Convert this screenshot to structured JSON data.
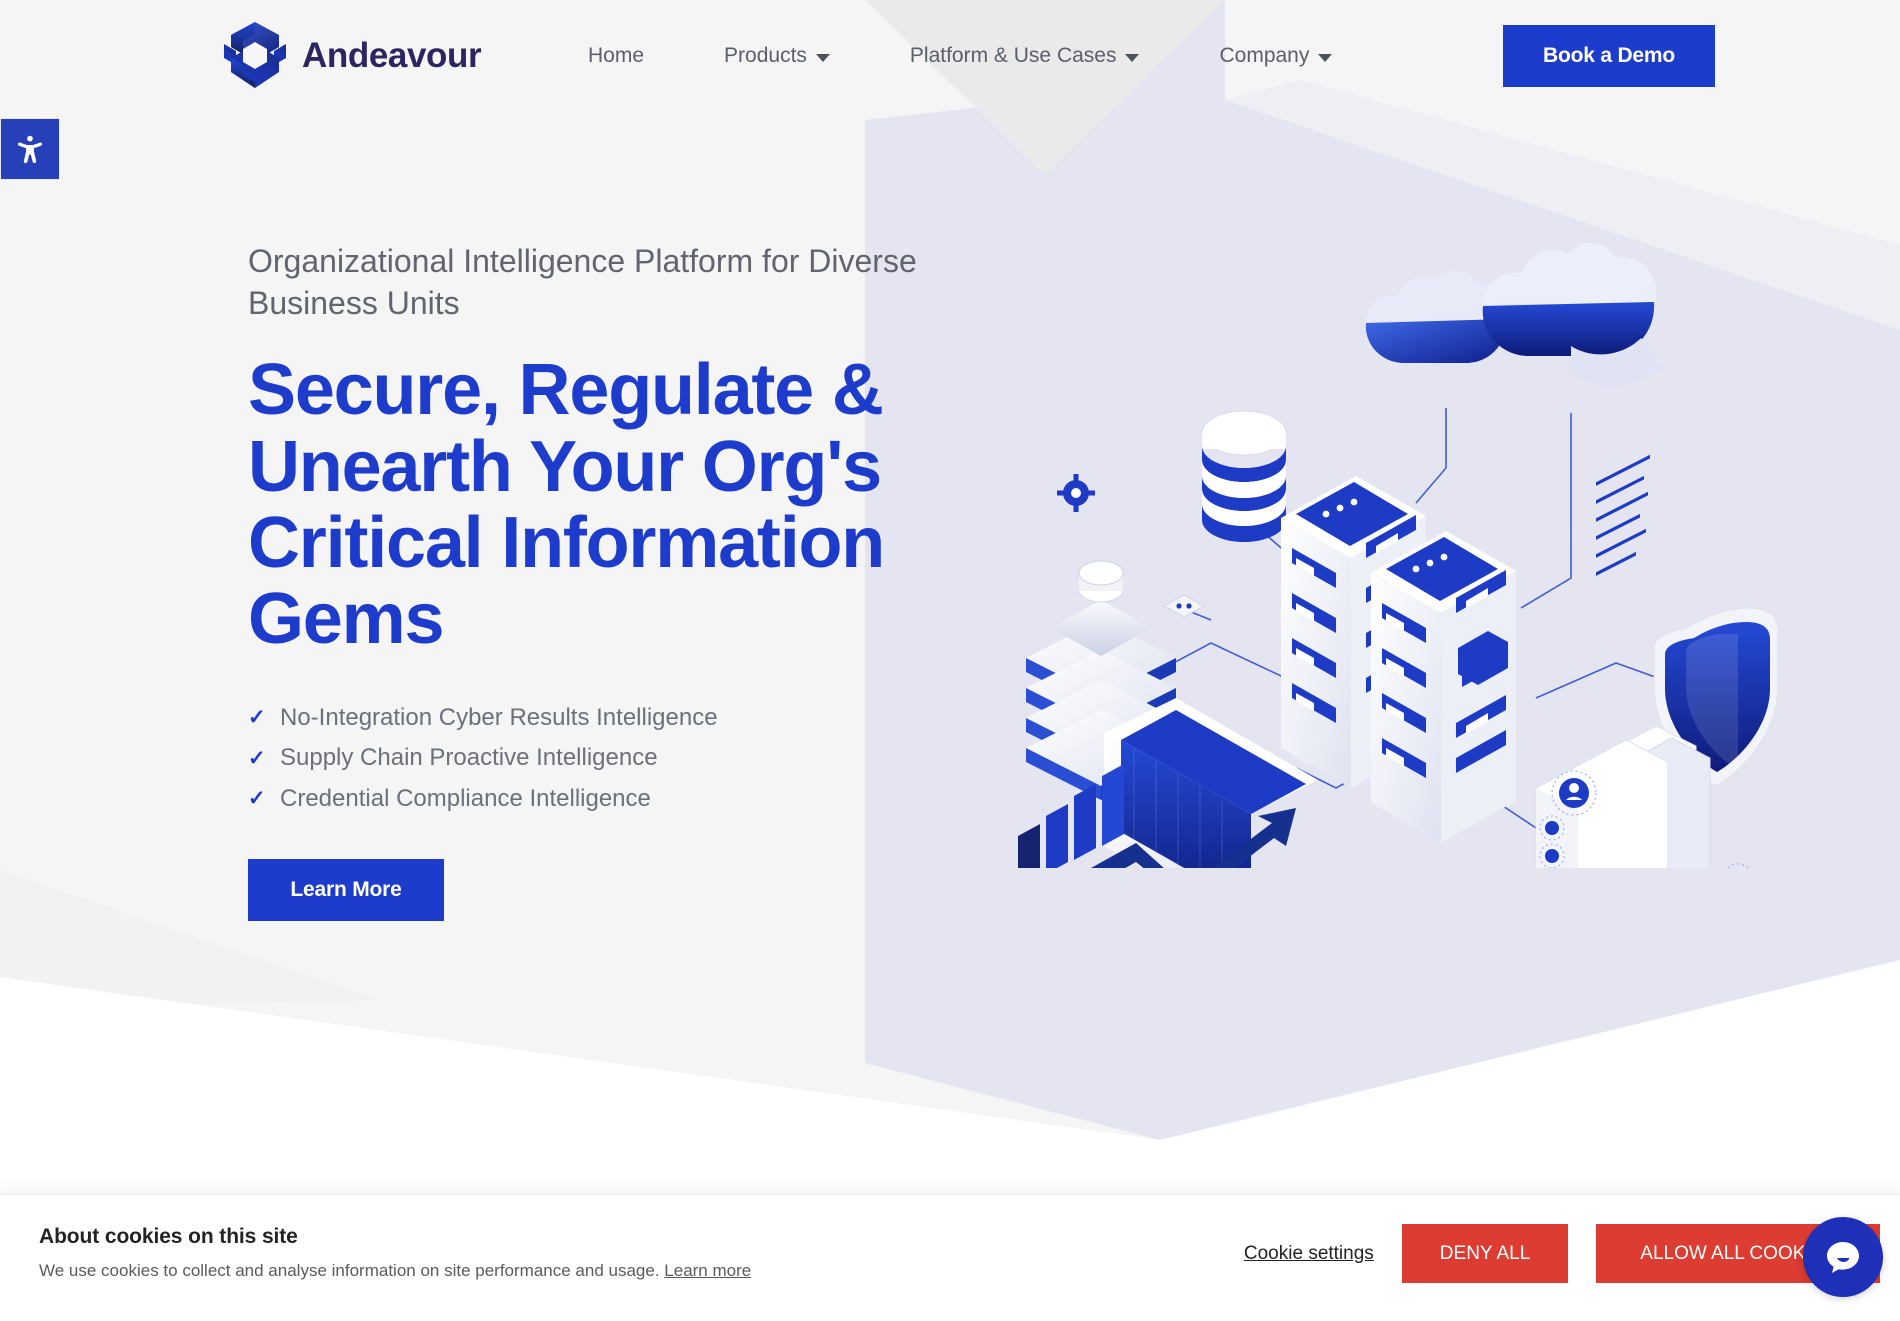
{
  "brand": {
    "name": "Andeavour",
    "logo_icon": "hexagon-cube-logo-icon"
  },
  "header": {
    "nav": [
      {
        "label": "Home",
        "has_caret": false
      },
      {
        "label": "Products",
        "has_caret": true
      },
      {
        "label": "Platform & Use Cases",
        "has_caret": true
      },
      {
        "label": "Company",
        "has_caret": true
      }
    ],
    "cta_label": "Book a Demo"
  },
  "accessibility": {
    "icon": "accessibility-person-icon",
    "tooltip": "Open accessibility options"
  },
  "hero": {
    "eyebrow": "Organizational Intelligence Platform for Diverse Business Units",
    "headline": "Secure, Regulate & Unearth Your Org's Critical Information Gems",
    "features": [
      "No-Integration Cyber Results Intelligence",
      "Supply Chain Proactive Intelligence",
      "Credential Compliance Intelligence"
    ],
    "check_icon": "check-mark-icon",
    "cta_label": "Learn More",
    "illustration": "isometric-cloud-data-infrastructure-illustration"
  },
  "cookies": {
    "title": "About cookies on this site",
    "description": "We use cookies to collect and analyse information on site performance and usage.",
    "learn_more_label": "Learn more",
    "settings_label": "Cookie settings",
    "deny_label": "DENY ALL",
    "allow_label": "ALLOW ALL COOKIES"
  },
  "chat": {
    "icon": "chat-bubble-icon"
  },
  "colors": {
    "brand_blue": "#1e3ccb",
    "brand_navy": "#2b2660",
    "cookie_red": "#dd3c32",
    "chat_blue": "#1e30b8",
    "page_bg": "#f6f6f7",
    "panel_lavender": "#e3e4ef"
  }
}
